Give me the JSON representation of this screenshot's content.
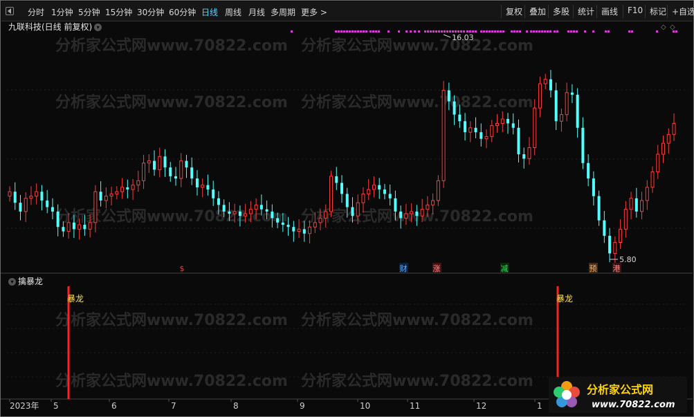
{
  "toolbar": {
    "tabs": [
      "分时",
      "1分钟",
      "5分钟",
      "15分钟",
      "30分钟",
      "60分钟",
      "日线",
      "周线",
      "月线",
      "多周期",
      "更多 >"
    ],
    "active_tab": "日线",
    "right_buttons": [
      "复权",
      "叠加",
      "多股",
      "统计",
      "画线",
      "F10",
      "标记",
      "+自选"
    ]
  },
  "main_panel": {
    "title": "九联科技(日线 前复权)",
    "watermark": "分析家公式网www.70822.com",
    "high_label": "16.03",
    "low_label": "5.80",
    "event_markers": [
      "$",
      "财",
      "涨",
      "减",
      "预",
      "港"
    ]
  },
  "indicator_panel": {
    "title": "擒暴龙",
    "signal_label": "暴龙"
  },
  "x_axis": {
    "labels": [
      "2023年",
      "5",
      "6",
      "7",
      "8",
      "9",
      "10",
      "11",
      "12",
      "1"
    ]
  },
  "logo": {
    "name": "分析家公式网",
    "url": "www.70822.com"
  },
  "colors": {
    "up": "#ff3b3b",
    "down": "#54ffff",
    "signal": "#ff2020",
    "dots": "#d23ed2",
    "active_tab": "#5fd3ff"
  },
  "chart_data": {
    "type": "candlestick",
    "high": 16.03,
    "low": 5.8,
    "closes": [
      8.9,
      8.4,
      8.0,
      8.6,
      8.7,
      8.9,
      8.5,
      8.2,
      8.0,
      7.3,
      7.1,
      7.5,
      7.2,
      7.4,
      7.2,
      7.5,
      8.9,
      8.5,
      8.7,
      8.8,
      8.9,
      9.1,
      9.0,
      9.2,
      9.4,
      10.2,
      10.3,
      9.9,
      10.5,
      10.0,
      9.6,
      9.5,
      10.3,
      10.0,
      9.5,
      9.1,
      9.2,
      9.0,
      8.6,
      8.3,
      8.0,
      7.9,
      8.0,
      7.8,
      7.9,
      8.1,
      8.3,
      8.1,
      8.0,
      7.7,
      7.5,
      7.4,
      7.3,
      7.1,
      7.2,
      7.0,
      7.3,
      7.5,
      7.7,
      8.0,
      9.6,
      9.3,
      8.8,
      8.2,
      7.8,
      8.4,
      8.8,
      9.0,
      9.2,
      9.0,
      8.8,
      8.6,
      8.0,
      7.7,
      7.9,
      8.0,
      7.8,
      8.1,
      8.3,
      8.5,
      9.4,
      13.5,
      13.0,
      12.4,
      12.1,
      11.6,
      11.8,
      11.6,
      11.3,
      11.4,
      11.9,
      12.0,
      12.2,
      12.0,
      11.8,
      10.6,
      10.4,
      10.9,
      12.7,
      13.8,
      14.0,
      13.5,
      12.1,
      12.4,
      13.4,
      13.3,
      11.8,
      10.2,
      9.5,
      8.7,
      7.6,
      6.9,
      6.1,
      6.6,
      7.2,
      8.1,
      8.6,
      8.0,
      8.5,
      9.1,
      9.8,
      10.6,
      11.1,
      11.5,
      12.0
    ]
  }
}
